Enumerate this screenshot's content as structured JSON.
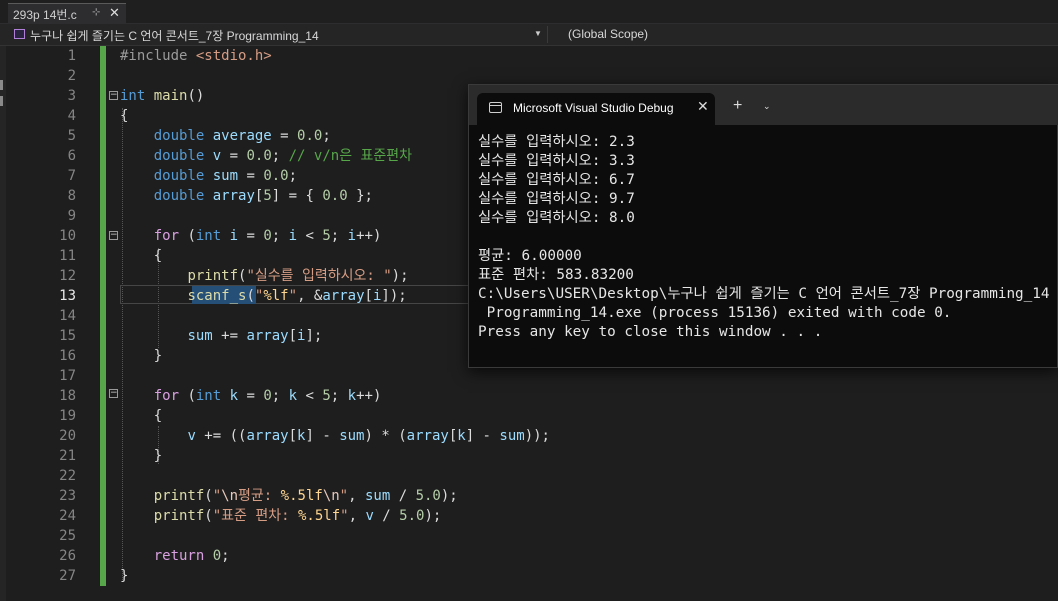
{
  "tab": {
    "title": "293p 14번.c",
    "pin_icon": "pin-icon",
    "close_icon": "close-icon",
    "close_glyph": "✕",
    "pin_glyph": "⊹"
  },
  "navbar": {
    "project": "누구나 쉽게 즐기는 C 언어 콘서트_7장 Programming_14",
    "scope": "(Global Scope)",
    "dropdown_glyph": "▼"
  },
  "editor": {
    "current_line": 13,
    "lines": [
      {
        "n": "1",
        "tokens": [
          {
            "c": "pre",
            "t": "#include "
          },
          {
            "c": "str",
            "t": "<stdio.h>"
          }
        ]
      },
      {
        "n": "2",
        "tokens": []
      },
      {
        "n": "3",
        "tokens": [
          {
            "c": "kw",
            "t": "int "
          },
          {
            "c": "fn",
            "t": "main"
          },
          {
            "c": "",
            "t": "()"
          }
        ]
      },
      {
        "n": "4",
        "tokens": [
          {
            "c": "",
            "t": "{"
          }
        ]
      },
      {
        "n": "5",
        "tokens": [
          {
            "c": "",
            "t": "    "
          },
          {
            "c": "kw",
            "t": "double "
          },
          {
            "c": "id",
            "t": "average"
          },
          {
            "c": "",
            "t": " = "
          },
          {
            "c": "num",
            "t": "0.0"
          },
          {
            "c": "",
            "t": ";"
          }
        ]
      },
      {
        "n": "6",
        "tokens": [
          {
            "c": "",
            "t": "    "
          },
          {
            "c": "kw",
            "t": "double "
          },
          {
            "c": "id",
            "t": "v"
          },
          {
            "c": "",
            "t": " = "
          },
          {
            "c": "num",
            "t": "0.0"
          },
          {
            "c": "",
            "t": "; "
          },
          {
            "c": "cmt",
            "t": "// v/n은 표준편차"
          }
        ]
      },
      {
        "n": "7",
        "tokens": [
          {
            "c": "",
            "t": "    "
          },
          {
            "c": "kw",
            "t": "double "
          },
          {
            "c": "id",
            "t": "sum"
          },
          {
            "c": "",
            "t": " = "
          },
          {
            "c": "num",
            "t": "0.0"
          },
          {
            "c": "",
            "t": ";"
          }
        ]
      },
      {
        "n": "8",
        "tokens": [
          {
            "c": "",
            "t": "    "
          },
          {
            "c": "kw",
            "t": "double "
          },
          {
            "c": "id",
            "t": "array"
          },
          {
            "c": "",
            "t": "["
          },
          {
            "c": "num",
            "t": "5"
          },
          {
            "c": "",
            "t": "] = { "
          },
          {
            "c": "num",
            "t": "0.0"
          },
          {
            "c": "",
            "t": " };"
          }
        ]
      },
      {
        "n": "9",
        "tokens": []
      },
      {
        "n": "10",
        "tokens": [
          {
            "c": "",
            "t": "    "
          },
          {
            "c": "ctl",
            "t": "for"
          },
          {
            "c": "",
            "t": " ("
          },
          {
            "c": "kw",
            "t": "int "
          },
          {
            "c": "id",
            "t": "i"
          },
          {
            "c": "",
            "t": " = "
          },
          {
            "c": "num",
            "t": "0"
          },
          {
            "c": "",
            "t": "; "
          },
          {
            "c": "id",
            "t": "i"
          },
          {
            "c": "",
            "t": " < "
          },
          {
            "c": "num",
            "t": "5"
          },
          {
            "c": "",
            "t": "; "
          },
          {
            "c": "id",
            "t": "i"
          },
          {
            "c": "",
            "t": "++)"
          }
        ]
      },
      {
        "n": "11",
        "tokens": [
          {
            "c": "",
            "t": "    {"
          }
        ]
      },
      {
        "n": "12",
        "tokens": [
          {
            "c": "",
            "t": "        "
          },
          {
            "c": "fn",
            "t": "printf"
          },
          {
            "c": "",
            "t": "("
          },
          {
            "c": "str",
            "t": "\"실수를 입력하시오: \""
          },
          {
            "c": "",
            "t": ");"
          }
        ]
      },
      {
        "n": "13",
        "tokens": [
          {
            "c": "",
            "t": "        "
          },
          {
            "c": "fn",
            "t": "scanf_s"
          },
          {
            "c": "",
            "t": "("
          },
          {
            "c": "str",
            "t": "\""
          },
          {
            "c": "fmt",
            "t": "%lf"
          },
          {
            "c": "str",
            "t": "\""
          },
          {
            "c": "",
            "t": ", &"
          },
          {
            "c": "id",
            "t": "array"
          },
          {
            "c": "",
            "t": "["
          },
          {
            "c": "id",
            "t": "i"
          },
          {
            "c": "",
            "t": "]);"
          }
        ]
      },
      {
        "n": "14",
        "tokens": []
      },
      {
        "n": "15",
        "tokens": [
          {
            "c": "",
            "t": "        "
          },
          {
            "c": "id",
            "t": "sum"
          },
          {
            "c": "",
            "t": " += "
          },
          {
            "c": "id",
            "t": "array"
          },
          {
            "c": "",
            "t": "["
          },
          {
            "c": "id",
            "t": "i"
          },
          {
            "c": "",
            "t": "];"
          }
        ]
      },
      {
        "n": "16",
        "tokens": [
          {
            "c": "",
            "t": "    }"
          }
        ]
      },
      {
        "n": "17",
        "tokens": []
      },
      {
        "n": "18",
        "tokens": [
          {
            "c": "",
            "t": "    "
          },
          {
            "c": "ctl",
            "t": "for"
          },
          {
            "c": "",
            "t": " ("
          },
          {
            "c": "kw",
            "t": "int "
          },
          {
            "c": "id",
            "t": "k"
          },
          {
            "c": "",
            "t": " = "
          },
          {
            "c": "num",
            "t": "0"
          },
          {
            "c": "",
            "t": "; "
          },
          {
            "c": "id",
            "t": "k"
          },
          {
            "c": "",
            "t": " < "
          },
          {
            "c": "num",
            "t": "5"
          },
          {
            "c": "",
            "t": "; "
          },
          {
            "c": "id",
            "t": "k"
          },
          {
            "c": "",
            "t": "++)"
          }
        ]
      },
      {
        "n": "19",
        "tokens": [
          {
            "c": "",
            "t": "    {"
          }
        ]
      },
      {
        "n": "20",
        "tokens": [
          {
            "c": "",
            "t": "        "
          },
          {
            "c": "id",
            "t": "v"
          },
          {
            "c": "",
            "t": " += (("
          },
          {
            "c": "id",
            "t": "array"
          },
          {
            "c": "",
            "t": "["
          },
          {
            "c": "id",
            "t": "k"
          },
          {
            "c": "",
            "t": "] - "
          },
          {
            "c": "id",
            "t": "sum"
          },
          {
            "c": "",
            "t": ") * ("
          },
          {
            "c": "id",
            "t": "array"
          },
          {
            "c": "",
            "t": "["
          },
          {
            "c": "id",
            "t": "k"
          },
          {
            "c": "",
            "t": "] - "
          },
          {
            "c": "id",
            "t": "sum"
          },
          {
            "c": "",
            "t": "));"
          }
        ]
      },
      {
        "n": "21",
        "tokens": [
          {
            "c": "",
            "t": "    }"
          }
        ]
      },
      {
        "n": "22",
        "tokens": []
      },
      {
        "n": "23",
        "tokens": [
          {
            "c": "",
            "t": "    "
          },
          {
            "c": "fn",
            "t": "printf"
          },
          {
            "c": "",
            "t": "("
          },
          {
            "c": "str",
            "t": "\""
          },
          {
            "c": "esc",
            "t": "\\n"
          },
          {
            "c": "str",
            "t": "평균: "
          },
          {
            "c": "fmt",
            "t": "%.5lf"
          },
          {
            "c": "esc",
            "t": "\\n"
          },
          {
            "c": "str",
            "t": "\""
          },
          {
            "c": "",
            "t": ", "
          },
          {
            "c": "id",
            "t": "sum"
          },
          {
            "c": "",
            "t": " / "
          },
          {
            "c": "num",
            "t": "5.0"
          },
          {
            "c": "",
            "t": ");"
          }
        ]
      },
      {
        "n": "24",
        "tokens": [
          {
            "c": "",
            "t": "    "
          },
          {
            "c": "fn",
            "t": "printf"
          },
          {
            "c": "",
            "t": "("
          },
          {
            "c": "str",
            "t": "\"표준 편차: "
          },
          {
            "c": "fmt",
            "t": "%.5lf"
          },
          {
            "c": "str",
            "t": "\""
          },
          {
            "c": "",
            "t": ", "
          },
          {
            "c": "id",
            "t": "v"
          },
          {
            "c": "",
            "t": " / "
          },
          {
            "c": "num",
            "t": "5.0"
          },
          {
            "c": "",
            "t": ");"
          }
        ]
      },
      {
        "n": "25",
        "tokens": []
      },
      {
        "n": "26",
        "tokens": [
          {
            "c": "",
            "t": "    "
          },
          {
            "c": "ctl",
            "t": "return "
          },
          {
            "c": "num",
            "t": "0"
          },
          {
            "c": "",
            "t": ";"
          }
        ]
      },
      {
        "n": "27",
        "tokens": [
          {
            "c": "",
            "t": "}"
          }
        ]
      }
    ]
  },
  "console": {
    "tab_title": "Microsoft Visual Studio Debug",
    "tab_close_glyph": "✕",
    "new_tab_glyph": "+",
    "dropdown_glyph": "⌄",
    "icon": "terminal-icon",
    "lines": [
      "실수를 입력하시오: 2.3",
      "실수를 입력하시오: 3.3",
      "실수를 입력하시오: 6.7",
      "실수를 입력하시오: 9.7",
      "실수를 입력하시오: 8.0",
      "",
      "평균: 6.00000",
      "표준 편차: 583.83200",
      "C:\\Users\\USER\\Desktop\\누구나 쉽게 즐기는 C 언어 콘서트_7장 Programming_14",
      " Programming_14.exe (process 15136) exited with code 0.",
      "Press any key to close this window . . ."
    ]
  },
  "colors": {
    "editor_bg": "#1e1e1e",
    "keyword": "#569cd6",
    "string": "#d69d85",
    "comment": "#57a64a",
    "identifier": "#9cdcfe",
    "function": "#dcdcaa",
    "change_bar": "#57a64a",
    "selection": "#264f78"
  }
}
